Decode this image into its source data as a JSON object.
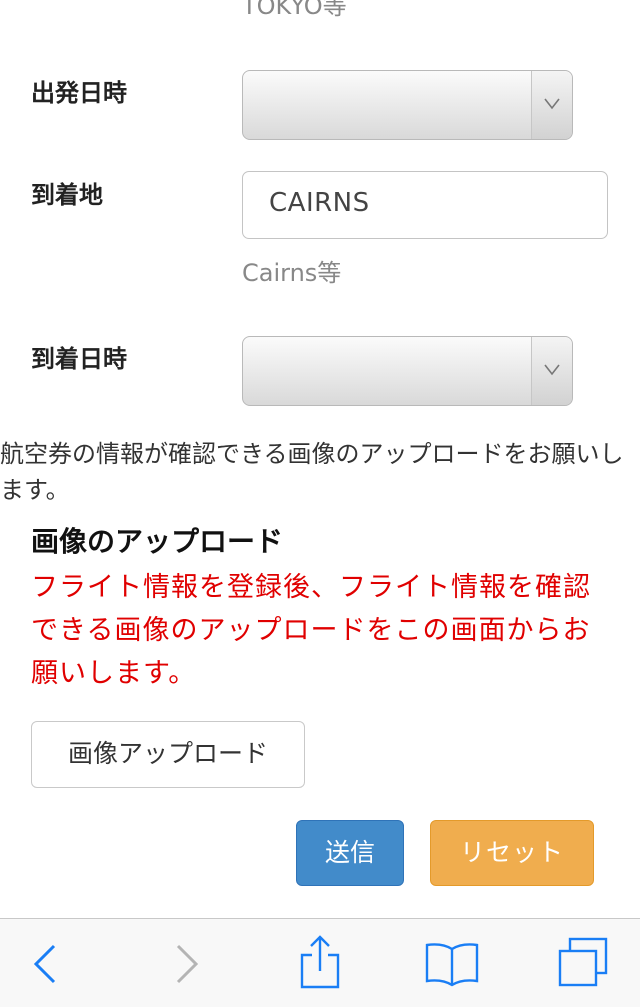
{
  "form": {
    "departure_hint": "TOKYO等",
    "departure_datetime_label": "出発日時",
    "departure_datetime_value": "",
    "arrival_place_label": "到着地",
    "arrival_place_value": "CAIRNS",
    "arrival_hint": "Cairns等",
    "arrival_datetime_label": "到着日時",
    "arrival_datetime_value": ""
  },
  "notice": {
    "instruction": "航空券の情報が確認できる画像のアップロードをお願いします。",
    "section_title": "画像のアップロード",
    "warning": "フライト情報を登録後、フライト情報を確認できる画像のアップロードをこの画面からお願いします。"
  },
  "buttons": {
    "upload": "画像アップロード",
    "submit": "送信",
    "reset": "リセット"
  },
  "colors": {
    "warning_text": "#e00000",
    "submit_bg": "#428bca",
    "reset_bg": "#f0ad4e",
    "ios_tint": "#1a7ef5"
  },
  "toolbar": {
    "icons": [
      "back-icon",
      "forward-icon",
      "share-icon",
      "bookmarks-icon",
      "tabs-icon"
    ]
  }
}
